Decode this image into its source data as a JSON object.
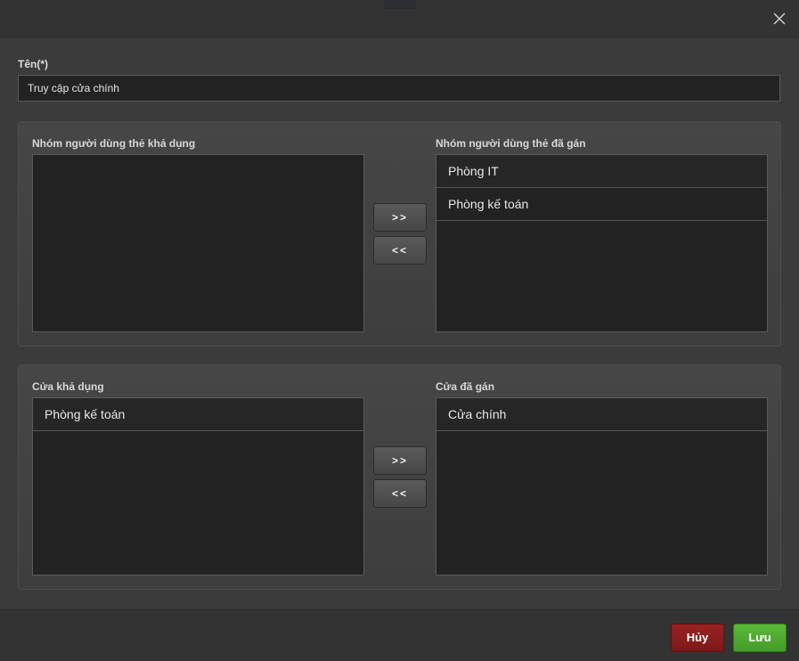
{
  "dialog": {
    "close_icon": "close-icon"
  },
  "form": {
    "name_label": "Tên(*)",
    "name_value": "Truy cập cửa chính"
  },
  "user_groups": {
    "available_label": "Nhóm người dùng thẻ khả dụng",
    "assigned_label": "Nhóm người dùng thẻ đã gán",
    "available_items": [],
    "assigned_items": [
      "Phòng IT",
      "Phòng kế toán"
    ],
    "add_label": ">>",
    "remove_label": "<<"
  },
  "doors": {
    "available_label": "Cửa khả dụng",
    "assigned_label": "Cửa đã gán",
    "available_items": [
      "Phòng kế toán"
    ],
    "assigned_items": [
      "Cửa chính"
    ],
    "add_label": ">>",
    "remove_label": "<<"
  },
  "footer": {
    "cancel_label": "Hủy",
    "save_label": "Lưu"
  },
  "colors": {
    "cancel": "#8b1e1e",
    "save": "#4cab30",
    "background": "#3b3b3b"
  }
}
